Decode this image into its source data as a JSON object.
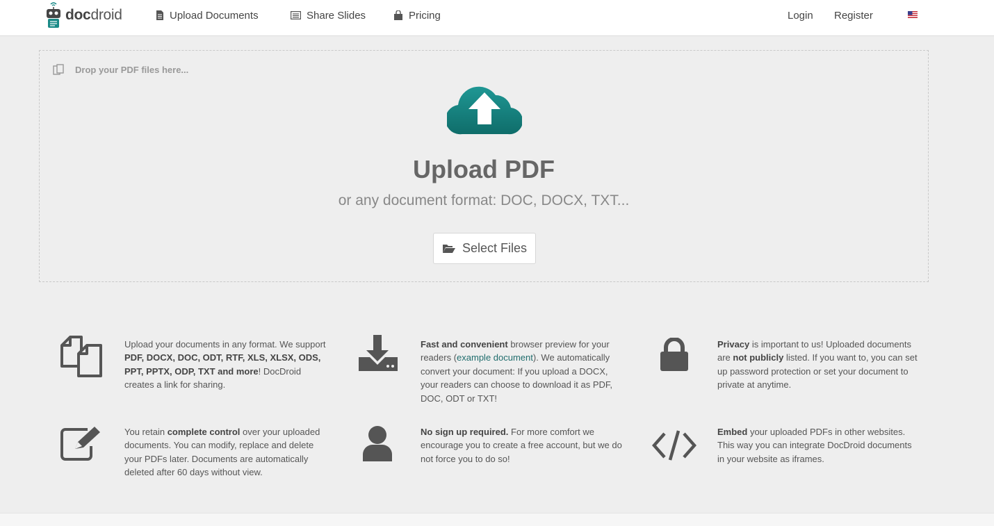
{
  "header": {
    "logo": {
      "part1": "doc",
      "part2": "droid"
    },
    "nav": [
      {
        "label": "Upload Documents",
        "icon": "file-icon"
      },
      {
        "label": "Share Slides",
        "icon": "slides-icon"
      },
      {
        "label": "Pricing",
        "icon": "shopping-bag-icon"
      }
    ],
    "login": "Login",
    "register": "Register",
    "language_flag": "us-flag-icon"
  },
  "upload": {
    "drop_hint": "Drop your PDF files here...",
    "title": "Upload PDF",
    "subtitle": "or any document format: DOC, DOCX, TXT...",
    "select_button": "Select Files"
  },
  "features": [
    {
      "icon": "copy-files-icon",
      "parts": [
        {
          "t": "Upload your documents in any format. We support "
        },
        {
          "t": "PDF, DOCX, DOC, ODT, RTF, XLS, XLSX, ODS, PPT, PPTX, ODP, TXT and more",
          "b": true
        },
        {
          "t": "! DocDroid creates a link for sharing."
        }
      ]
    },
    {
      "icon": "download-tray-icon",
      "parts": [
        {
          "t": "Fast and convenient",
          "b": true
        },
        {
          "t": " browser preview for your readers ("
        },
        {
          "t": "example document",
          "link": true
        },
        {
          "t": "). We automatically convert your document: If you upload a DOCX, your readers can choose to download it as PDF, DOC, ODT or TXT!"
        }
      ]
    },
    {
      "icon": "lock-icon",
      "parts": [
        {
          "t": "Privacy",
          "b": true
        },
        {
          "t": " is important to us! Uploaded documents are "
        },
        {
          "t": "not publicly",
          "b": true
        },
        {
          "t": " listed. If you want to, you can set up password protection or set your document to private at anytime."
        }
      ]
    },
    {
      "icon": "edit-icon",
      "parts": [
        {
          "t": "You retain "
        },
        {
          "t": "complete control",
          "b": true
        },
        {
          "t": " over your uploaded documents. You can modify, replace and delete your PDFs later. Documents are automatically deleted after 60 days without view."
        }
      ]
    },
    {
      "icon": "user-icon",
      "parts": [
        {
          "t": "No sign up required.",
          "b": true
        },
        {
          "t": " For more comfort we encourage you to create a free account, but we do not force you to do so!"
        }
      ]
    },
    {
      "icon": "code-icon",
      "parts": [
        {
          "t": "Embed",
          "b": true
        },
        {
          "t": " your uploaded PDFs in other websites. This way you can integrate DocDroid documents in your website as iframes."
        }
      ]
    }
  ],
  "colors": {
    "accent": "#1b8a87",
    "accent_dark": "#0f6b69",
    "icon_gray": "#555555"
  }
}
